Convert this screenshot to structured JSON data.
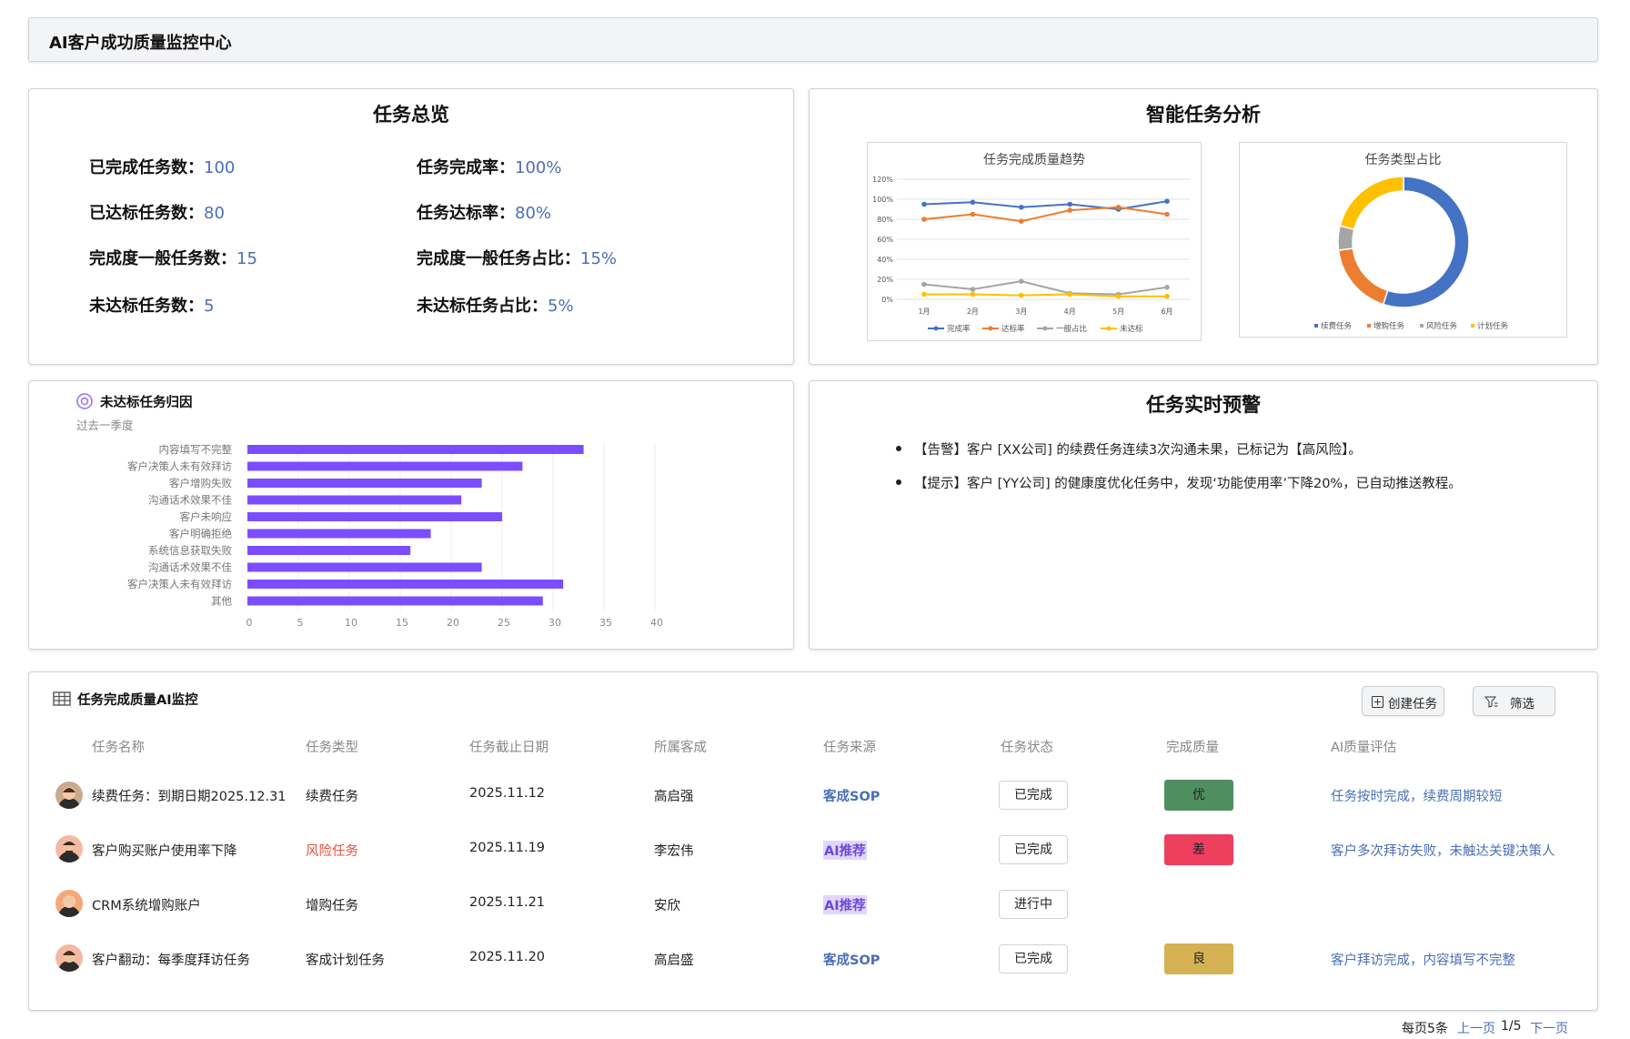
{
  "app_title": "AI客户成功质量监控中心",
  "overview": {
    "title": "任务总览",
    "stats": [
      {
        "label": "已完成任务数：",
        "value": "100"
      },
      {
        "label": "任务完成率：",
        "value": "100%"
      },
      {
        "label": "已达标任务数：",
        "value": "80"
      },
      {
        "label": "任务达标率：",
        "value": "80%"
      },
      {
        "label": "完成度一般任务数：",
        "value": "15"
      },
      {
        "label": "完成度一般任务占比：",
        "value": "15%"
      },
      {
        "label": "未达标任务数：",
        "value": "5"
      },
      {
        "label": "未达标任务占比：",
        "value": "5%"
      }
    ]
  },
  "analysis": {
    "title": "智能任务分析",
    "trend_chart": {
      "title": "任务完成质量趋势",
      "y_ticks": [
        "0%",
        "20%",
        "40%",
        "60%",
        "80%",
        "100%",
        "120%"
      ],
      "x_ticks": [
        "1月",
        "2月",
        "3月",
        "4月",
        "5月",
        "6月"
      ],
      "legend": [
        "完成率",
        "达标率",
        "一般占比",
        "未达标"
      ]
    },
    "type_chart": {
      "title": "任务类型占比",
      "legend": [
        "续费任务",
        "增购任务",
        "风险任务",
        "计划任务"
      ]
    }
  },
  "attribution": {
    "title": "未达标任务归因",
    "subtitle": "过去一季度",
    "x_ticks": [
      "0",
      "5",
      "10",
      "15",
      "20",
      "25",
      "30",
      "35",
      "40"
    ]
  },
  "alerts": {
    "title": "任务实时预警",
    "items": [
      "【告警】客户 [XX公司] 的续费任务连续3次沟通未果，已标记为【高风险】。",
      "【提示】客户 [YY公司] 的健康度优化任务中，发现‘功能使用率’下降20%，已自动推送教程。"
    ]
  },
  "monitor": {
    "title": "任务完成质量AI监控",
    "create_btn": "创建任务",
    "filter_btn": "筛选",
    "columns": [
      "任务名称",
      "任务类型",
      "任务截止日期",
      "所属客成",
      "任务来源",
      "任务状态",
      "完成质量",
      "AI质量评估"
    ],
    "rows": [
      {
        "name": "续费任务：到期日期2025.12.31",
        "type": "续费任务",
        "date": "2025.11.12",
        "owner": "高启强",
        "source": "客成SOP",
        "status": "已完成",
        "quality": "优",
        "eval": "任务按时完成，续费周期较短"
      },
      {
        "name": "客户购买账户使用率下降",
        "type": "风险任务",
        "date": "2025.11.19",
        "owner": "李宏伟",
        "source": "AI推荐",
        "status": "已完成",
        "quality": "差",
        "eval": "客户多次拜访失败，未触达关键决策人"
      },
      {
        "name": "CRM系统增购账户",
        "type": "增购任务",
        "date": "2025.11.21",
        "owner": "安欣",
        "source": "AI推荐",
        "status": "进行中",
        "quality": "",
        "eval": ""
      },
      {
        "name": "客户翻动：每季度拜访任务",
        "type": "客成计划任务",
        "date": "2025.11.20",
        "owner": "高启盛",
        "source": "客成SOP",
        "status": "已完成",
        "quality": "良",
        "eval": "客户拜访完成，内容填写不完整"
      }
    ],
    "pager": {
      "per_page": "每页5条",
      "prev": "上一页",
      "page": "1/5",
      "next": "下一页"
    }
  },
  "colors": {
    "accent": "#4a6fb5",
    "bar": "#7c4dff",
    "good": "#4f8f5f",
    "bad": "#ef3f5e",
    "mid": "#d4b153",
    "risk": "#e0533d"
  },
  "chart_data": [
    {
      "type": "line",
      "title": "任务完成质量趋势",
      "x": [
        "1月",
        "2月",
        "3月",
        "4月",
        "5月",
        "6月"
      ],
      "ylim": [
        0,
        120
      ],
      "series": [
        {
          "name": "完成率",
          "color": "#4472c4",
          "values": [
            95,
            97,
            92,
            95,
            90,
            98
          ]
        },
        {
          "name": "达标率",
          "color": "#ed7d31",
          "values": [
            80,
            85,
            78,
            89,
            92,
            85
          ]
        },
        {
          "name": "一般占比",
          "color": "#a5a5a5",
          "values": [
            15,
            10,
            18,
            6,
            5,
            12
          ]
        },
        {
          "name": "未达标",
          "color": "#ffc000",
          "values": [
            5,
            5,
            4,
            5,
            3,
            3
          ]
        }
      ]
    },
    {
      "type": "pie",
      "title": "任务类型占比",
      "categories": [
        "续费任务",
        "增购任务",
        "风险任务",
        "计划任务"
      ],
      "values": [
        55,
        18,
        6,
        21
      ],
      "colors": [
        "#4472c4",
        "#ed7d31",
        "#a5a5a5",
        "#ffc000"
      ]
    },
    {
      "type": "bar",
      "title": "未达标任务归因",
      "categories": [
        "内容填写不完整",
        "客户决策人未有效拜访",
        "客户增购失败",
        "沟通话术效果不佳",
        "客户未响应",
        "客户明确拒绝",
        "系统信息获取失败",
        "沟通话术效果不佳",
        "客户决策人未有效拜访",
        "其他"
      ],
      "values": [
        33,
        27,
        23,
        21,
        25,
        18,
        16,
        23,
        31,
        29
      ],
      "xlim": [
        0,
        40
      ]
    }
  ]
}
